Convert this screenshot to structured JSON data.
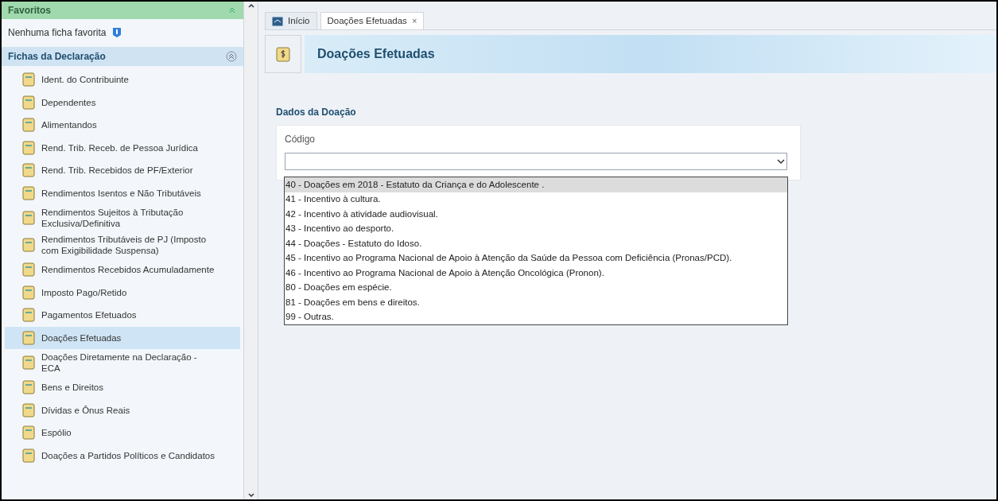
{
  "sidebar": {
    "favorites": {
      "title": "Favoritos",
      "empty_text": "Nenhuma ficha favorita"
    },
    "section": {
      "title": "Fichas da Declaração",
      "items": [
        {
          "label": "Ident. do Contribuinte",
          "selected": false
        },
        {
          "label": "Dependentes",
          "selected": false
        },
        {
          "label": "Alimentandos",
          "selected": false
        },
        {
          "label": "Rend. Trib. Receb. de Pessoa Jurídica",
          "selected": false
        },
        {
          "label": "Rend. Trib. Recebidos de PF/Exterior",
          "selected": false
        },
        {
          "label": "Rendimentos Isentos e Não Tributáveis",
          "selected": false
        },
        {
          "label": "Rendimentos Sujeitos à Tributação Exclusiva/Definitiva",
          "selected": false
        },
        {
          "label": "Rendimentos Tributáveis de PJ (Imposto com Exigibilidade Suspensa)",
          "selected": false
        },
        {
          "label": "Rendimentos Recebidos Acumuladamente",
          "selected": false
        },
        {
          "label": "Imposto Pago/Retido",
          "selected": false
        },
        {
          "label": "Pagamentos Efetuados",
          "selected": false
        },
        {
          "label": "Doações Efetuadas",
          "selected": true
        },
        {
          "label": "Doações Diretamente na Declaração - ECA",
          "selected": false
        },
        {
          "label": "Bens e Direitos",
          "selected": false
        },
        {
          "label": "Dívidas e Ônus Reais",
          "selected": false
        },
        {
          "label": "Espólio",
          "selected": false
        },
        {
          "label": "Doações a Partidos Políticos e Candidatos",
          "selected": false
        }
      ]
    }
  },
  "tabs": [
    {
      "label": "Início",
      "selected": false
    },
    {
      "label": "Doações Efetuadas",
      "selected": true,
      "close": "×"
    }
  ],
  "page": {
    "title": "Doações Efetuadas",
    "section_title": "Dados da Doação",
    "field": {
      "label": "Código",
      "expanded": true,
      "options": [
        {
          "label": "40 - Doações em 2018 - Estatuto da Criança e do Adolescente .",
          "selected": true
        },
        {
          "label": "41 - Incentivo à cultura.",
          "selected": false
        },
        {
          "label": "42 - Incentivo à atividade audiovisual.",
          "selected": false
        },
        {
          "label": "43 - Incentivo ao desporto.",
          "selected": false
        },
        {
          "label": "44 - Doações - Estatuto do Idoso.",
          "selected": false
        },
        {
          "label": "45 - Incentivo ao Programa Nacional de Apoio à Atenção da Saúde da Pessoa com Deficiência (Pronas/PCD).",
          "selected": false
        },
        {
          "label": "46 - Incentivo ao Programa Nacional de Apoio à Atenção Oncológica (Pronon).",
          "selected": false
        },
        {
          "label": "80 - Doações em espécie.",
          "selected": false
        },
        {
          "label": "81 - Doações em bens e direitos.",
          "selected": false
        },
        {
          "label": "99 - Outras.",
          "selected": false
        }
      ]
    }
  }
}
